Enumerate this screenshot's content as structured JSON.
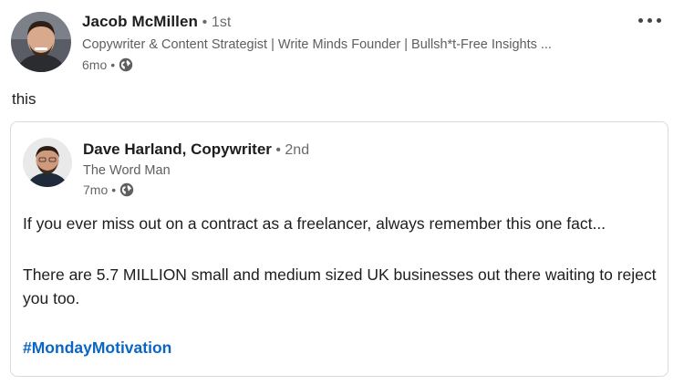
{
  "author": {
    "name": "Jacob McMillen",
    "degree": " • 1st",
    "headline": "Copywriter & Content Strategist | Write Minds Founder | Bullsh*t-Free Insights ...",
    "time": "6mo",
    "dot": "•"
  },
  "commentary": "this",
  "original_post": {
    "author_name": "Dave Harland, Copywriter",
    "degree": " • 2nd",
    "headline": "The Word Man",
    "time": "7mo",
    "dot": "•",
    "paragraph_1": "If you ever miss out on a contract as a freelancer, always remember this one fact...",
    "paragraph_2": "There are 5.7 MILLION small and medium sized UK businesses out there waiting to reject you too.",
    "hashtag": "#MondayMotivation"
  },
  "icons": {
    "visibility": "globe-icon",
    "menu": "more-options-icon"
  },
  "colors": {
    "hashtag": "#0a66c2",
    "text": "#1d1d1d",
    "secondary": "#666666"
  }
}
